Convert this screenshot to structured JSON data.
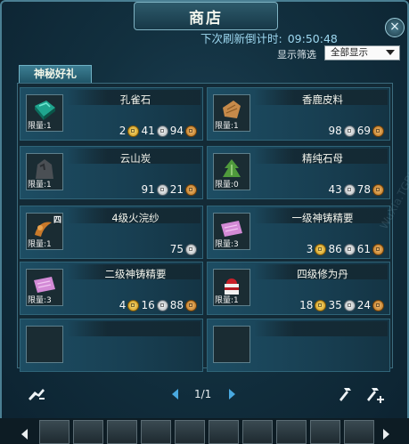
{
  "window": {
    "title": "商店",
    "close_label": "×"
  },
  "header": {
    "refresh_label": "下次刷新倒计时:",
    "refresh_time": "09:50:48",
    "filter_label": "显示筛选",
    "filter_value": "全部显示"
  },
  "tab": {
    "label": "神秘好礼"
  },
  "items": [
    {
      "name": "孔雀石",
      "limit": "限量:1",
      "icon": "peacock-stone-icon",
      "price": [
        {
          "amount": "2",
          "coin": "gold"
        },
        {
          "amount": "41",
          "coin": "silver"
        },
        {
          "amount": "94",
          "coin": "copper"
        }
      ]
    },
    {
      "name": "香鹿皮料",
      "limit": "限量:1",
      "icon": "deer-leather-icon",
      "price": [
        {
          "amount": "98",
          "coin": "silver"
        },
        {
          "amount": "69",
          "coin": "copper"
        }
      ]
    },
    {
      "name": "云山炭",
      "limit": "限量:1",
      "icon": "cloud-mountain-charcoal-icon",
      "price": [
        {
          "amount": "91",
          "coin": "silver"
        },
        {
          "amount": "21",
          "coin": "copper"
        }
      ]
    },
    {
      "name": "精纯石母",
      "limit": "限量:0",
      "icon": "pure-stone-mother-icon",
      "price": [
        {
          "amount": "43",
          "coin": "silver"
        },
        {
          "amount": "78",
          "coin": "copper"
        }
      ]
    },
    {
      "name": "4级火浣纱",
      "limit": "限量:1",
      "icon": "fire-silk-icon",
      "badge": "四",
      "price": [
        {
          "amount": "75",
          "coin": "silver"
        }
      ]
    },
    {
      "name": "一级神铸精要",
      "limit": "限量:3",
      "icon": "forge-scroll-icon",
      "price": [
        {
          "amount": "3",
          "coin": "gold"
        },
        {
          "amount": "86",
          "coin": "silver"
        },
        {
          "amount": "61",
          "coin": "copper"
        }
      ]
    },
    {
      "name": "二级神铸精要",
      "limit": "限量:3",
      "icon": "forge-scroll-icon",
      "price": [
        {
          "amount": "4",
          "coin": "gold"
        },
        {
          "amount": "16",
          "coin": "silver"
        },
        {
          "amount": "88",
          "coin": "copper"
        }
      ]
    },
    {
      "name": "四级修为丹",
      "limit": "限量:1",
      "icon": "cultivation-pill-icon",
      "price": [
        {
          "amount": "18",
          "coin": "gold"
        },
        {
          "amount": "35",
          "coin": "silver"
        },
        {
          "amount": "24",
          "coin": "copper"
        }
      ]
    },
    {
      "name": "",
      "limit": "",
      "icon": "",
      "price": []
    },
    {
      "name": "",
      "limit": "",
      "icon": "",
      "price": []
    }
  ],
  "pager": {
    "text": "1/1"
  },
  "colors": {
    "accent": "#9ed8f0",
    "panel": "#132a36",
    "card": "#1d4d63"
  }
}
